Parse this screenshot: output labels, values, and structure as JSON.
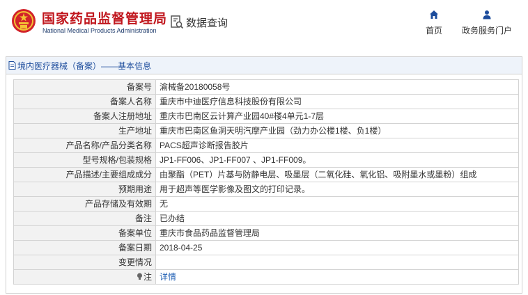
{
  "header": {
    "site_name_cn": "国家药品监督管理局",
    "site_name_en": "National Medical Products Administration",
    "query_label": "数据查询",
    "nav": {
      "home": "首页",
      "gov_portal": "政务服务门户"
    }
  },
  "panel": {
    "title": "境内医疗器械（备案）——基本信息"
  },
  "rows": [
    {
      "label": "备案号",
      "value": "渝械备20180058号"
    },
    {
      "label": "备案人名称",
      "value": "重庆市中迪医疗信息科技股份有限公司"
    },
    {
      "label": "备案人注册地址",
      "value": "重庆市巴南区云计算产业园40#楼4单元1-7层"
    },
    {
      "label": "生产地址",
      "value": "重庆市巴南区鱼洞天明汽摩产业园（劲力办公楼1楼、负1楼）"
    },
    {
      "label": "产品名称/产品分类名称",
      "value": "PACS超声诊断报告胶片"
    },
    {
      "label": "型号规格/包装规格",
      "value": "JP1-FF006、JP1-FF007 、JP1-FF009。"
    },
    {
      "label": "产品描述/主要组成成分",
      "value": "由聚酯（PET）片基与防静电层、吸墨层（二氧化硅、氧化铝、吸附墨水或墨粉）组成"
    },
    {
      "label": "预期用途",
      "value": "用于超声等医学影像及图文的打印记录。"
    },
    {
      "label": "产品存储及有效期",
      "value": "无"
    },
    {
      "label": "备注",
      "value": "已办结"
    },
    {
      "label": "备案单位",
      "value": "重庆市食品药品监督管理局"
    },
    {
      "label": "备案日期",
      "value": "2018-04-25"
    },
    {
      "label": "变更情况",
      "value": ""
    },
    {
      "label": "注",
      "value": "详情"
    }
  ],
  "colors": {
    "brand_red": "#c0161d",
    "link_blue": "#1f5fb4",
    "nav_blue": "#1c4c9c"
  },
  "icons": [
    "national-emblem-icon",
    "search-document-icon",
    "home-icon",
    "user-icon",
    "document-icon",
    "lightbulb-icon"
  ]
}
